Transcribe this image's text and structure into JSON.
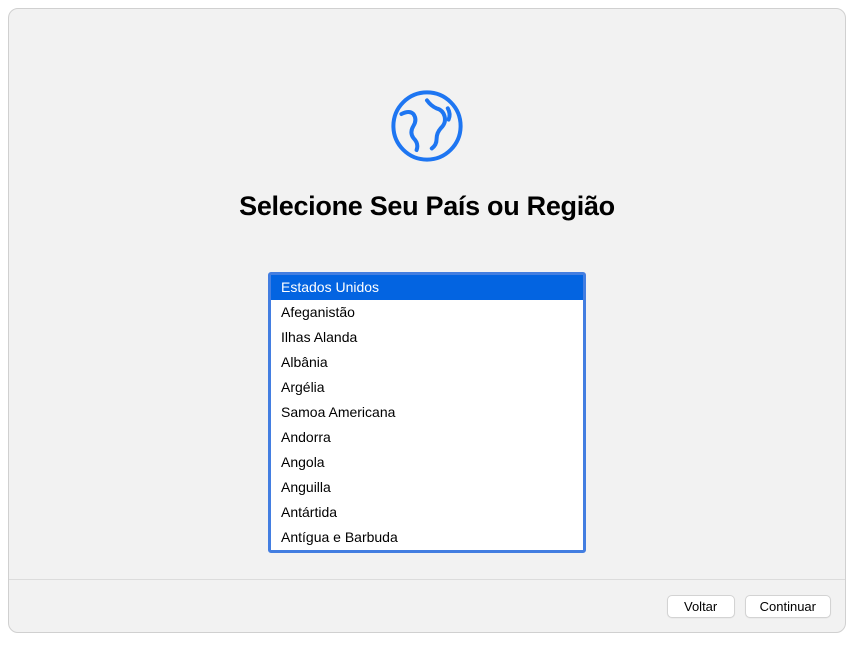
{
  "title": "Selecione Seu País ou Região",
  "countries": {
    "items": [
      "Estados Unidos",
      "Afeganistão",
      "Ilhas Alanda",
      "Albânia",
      "Argélia",
      "Samoa Americana",
      "Andorra",
      "Angola",
      "Anguilla",
      "Antártida",
      "Antígua e Barbuda"
    ],
    "selectedIndex": 0
  },
  "buttons": {
    "back": "Voltar",
    "continue": "Continuar"
  }
}
